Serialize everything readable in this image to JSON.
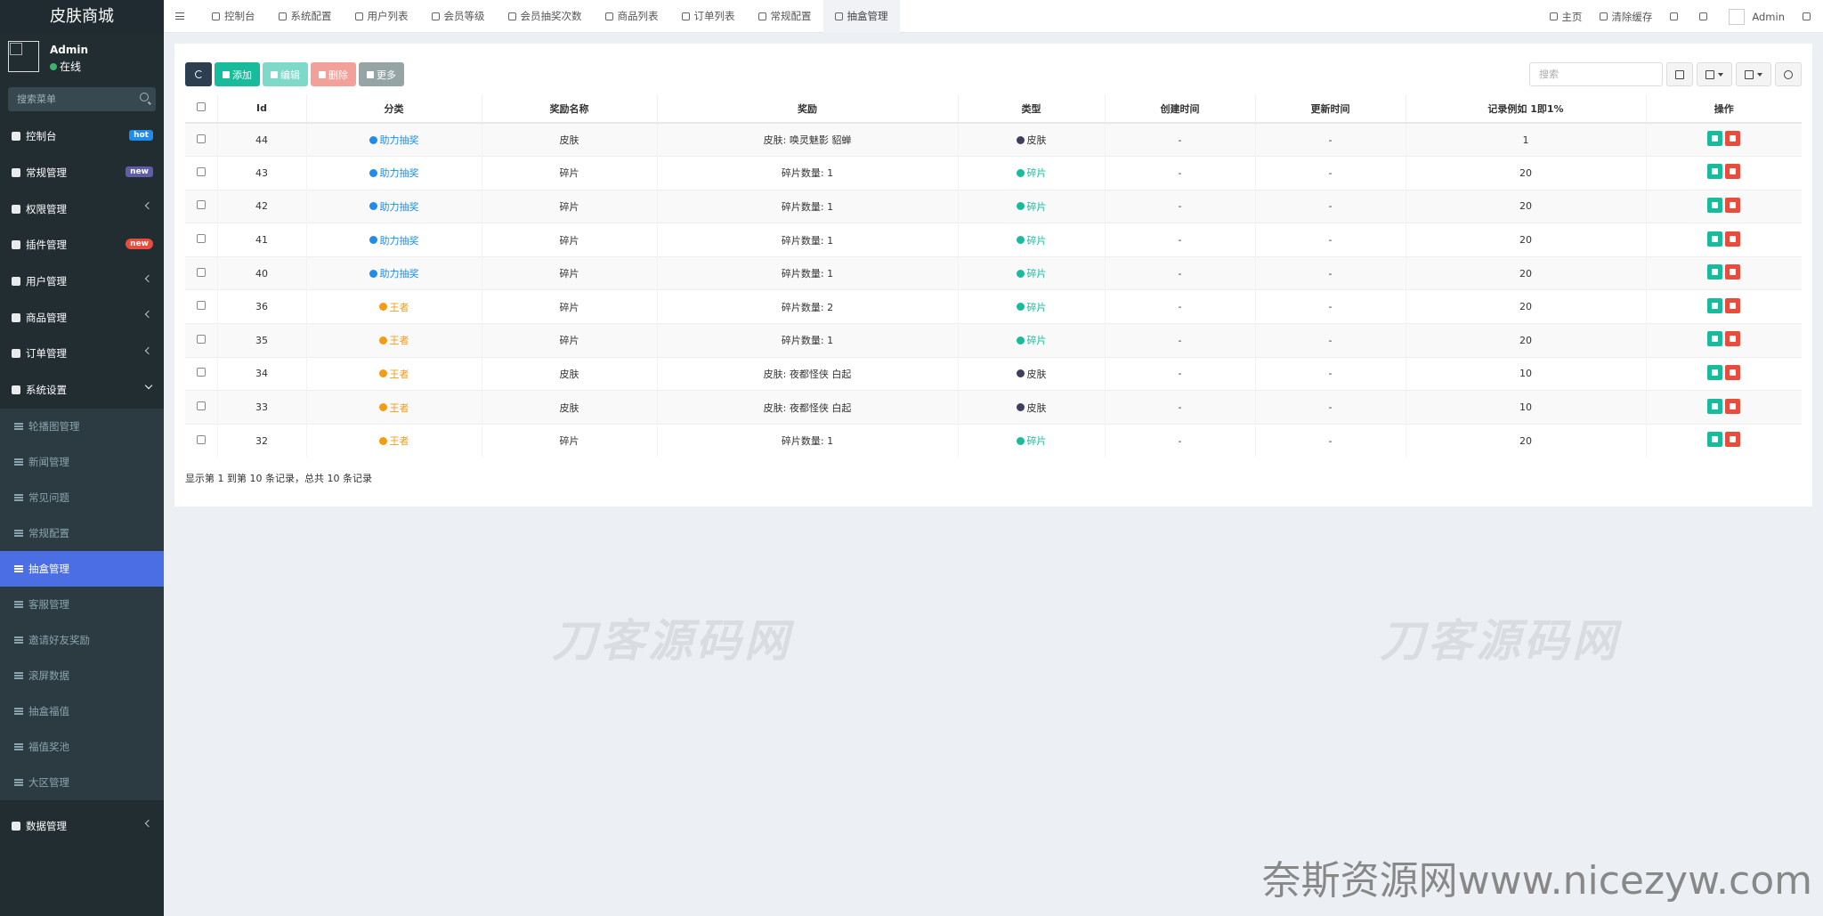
{
  "sidebar": {
    "logo": "皮肤商城",
    "user": {
      "name": "Admin",
      "status": "在线"
    },
    "search_placeholder": "搜索菜单",
    "menu": [
      {
        "label": "控制台",
        "badge": "hot"
      },
      {
        "label": "常规管理",
        "badge": "new"
      },
      {
        "label": "权限管理"
      },
      {
        "label": "插件管理",
        "badge": "new"
      },
      {
        "label": "用户管理"
      },
      {
        "label": "商品管理"
      },
      {
        "label": "订单管理"
      },
      {
        "label": "系统设置"
      }
    ],
    "submenu": [
      "轮播图管理",
      "新闻管理",
      "常见问题",
      "常规配置",
      "抽盒管理",
      "客服管理",
      "邀请好友奖励",
      "滚屏数据",
      "抽盒福值",
      "福值奖池",
      "大区管理"
    ],
    "active_sub": "抽盒管理",
    "bottom_menu": "数据管理"
  },
  "topbar": {
    "tabs": [
      "控制台",
      "系统配置",
      "用户列表",
      "会员等级",
      "会员抽奖次数",
      "商品列表",
      "订单列表",
      "常规配置",
      "抽盒管理"
    ],
    "active_tab": "抽盒管理",
    "right": {
      "home": "主页",
      "clear_cache": "清除缓存",
      "user": "Admin"
    }
  },
  "toolbar": {
    "add": "添加",
    "edit": "编辑",
    "delete": "删除",
    "more": "更多"
  },
  "search_placeholder": "搜索",
  "table": {
    "headers": [
      "Id",
      "分类",
      "奖励名称",
      "奖励",
      "类型",
      "创建时间",
      "更新时间",
      "记录例如 1即1%",
      "操作"
    ],
    "rows": [
      {
        "id": "44",
        "category": "助力抽奖",
        "name": "皮肤",
        "reward": "皮肤: 唤灵魅影 貂蝉",
        "type": "皮肤",
        "created": "-",
        "updated": "-",
        "record": "1"
      },
      {
        "id": "43",
        "category": "助力抽奖",
        "name": "碎片",
        "reward": "碎片数量: 1",
        "type": "碎片",
        "created": "-",
        "updated": "-",
        "record": "20"
      },
      {
        "id": "42",
        "category": "助力抽奖",
        "name": "碎片",
        "reward": "碎片数量: 1",
        "type": "碎片",
        "created": "-",
        "updated": "-",
        "record": "20"
      },
      {
        "id": "41",
        "category": "助力抽奖",
        "name": "碎片",
        "reward": "碎片数量: 1",
        "type": "碎片",
        "created": "-",
        "updated": "-",
        "record": "20"
      },
      {
        "id": "40",
        "category": "助力抽奖",
        "name": "碎片",
        "reward": "碎片数量: 1",
        "type": "碎片",
        "created": "-",
        "updated": "-",
        "record": "20"
      },
      {
        "id": "36",
        "category": "王者",
        "name": "碎片",
        "reward": "碎片数量: 2",
        "type": "碎片",
        "created": "-",
        "updated": "-",
        "record": "20"
      },
      {
        "id": "35",
        "category": "王者",
        "name": "碎片",
        "reward": "碎片数量: 1",
        "type": "碎片",
        "created": "-",
        "updated": "-",
        "record": "20"
      },
      {
        "id": "34",
        "category": "王者",
        "name": "皮肤",
        "reward": "皮肤: 夜都怪侠 白起",
        "type": "皮肤",
        "created": "-",
        "updated": "-",
        "record": "10"
      },
      {
        "id": "33",
        "category": "王者",
        "name": "皮肤",
        "reward": "皮肤: 夜都怪侠 白起",
        "type": "皮肤",
        "created": "-",
        "updated": "-",
        "record": "10"
      },
      {
        "id": "32",
        "category": "王者",
        "name": "碎片",
        "reward": "碎片数量: 1",
        "type": "碎片",
        "created": "-",
        "updated": "-",
        "record": "20"
      }
    ]
  },
  "pager_text": "显示第 1 到第 10 条记录，总共 10 条记录",
  "watermarks": {
    "center": "刀客源码网",
    "corner": "奈斯资源网www.nicezyw.com"
  },
  "colors": {
    "cat_assist": "#1f8ceb",
    "cat_king": "#f39c12",
    "type_skin": "#3d3f5c",
    "type_shard": "#18bc9c",
    "active_sub_bg": "#4c6ee4"
  }
}
